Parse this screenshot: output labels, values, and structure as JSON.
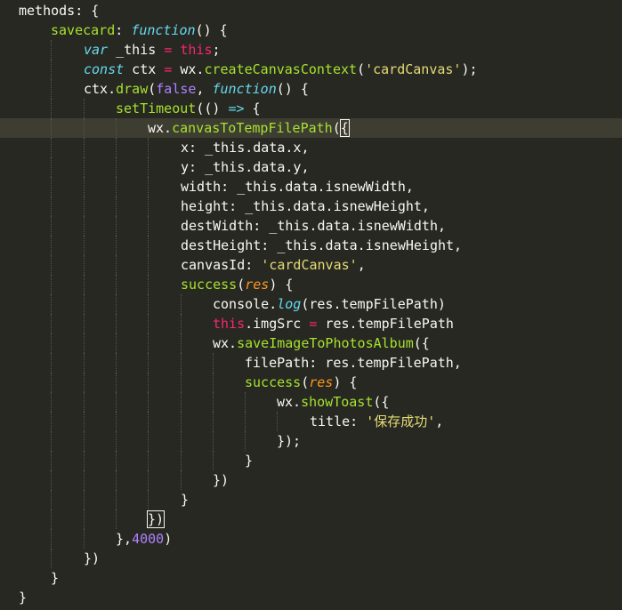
{
  "editor": {
    "theme_colors": {
      "background": "#272822",
      "current_line": "#3e3d32",
      "text": "#f8f8f2",
      "keyword": "#66d9ef",
      "function": "#a6e22e",
      "operator": "#f92672",
      "constant": "#ae81ff",
      "string": "#e6db74",
      "parameter": "#fd971f"
    },
    "current_line_index": 6,
    "lines": [
      {
        "indent": 0,
        "tokens": [
          {
            "t": "methods: {",
            "c": "pl"
          }
        ]
      },
      {
        "indent": 1,
        "tokens": [
          {
            "t": "savecard",
            "c": "fn"
          },
          {
            "t": ": ",
            "c": "pl"
          },
          {
            "t": "function",
            "c": "kw"
          },
          {
            "t": "() {",
            "c": "pl"
          }
        ]
      },
      {
        "indent": 2,
        "tokens": [
          {
            "t": "var",
            "c": "kw"
          },
          {
            "t": " _this ",
            "c": "pl"
          },
          {
            "t": "=",
            "c": "op"
          },
          {
            "t": " ",
            "c": "pl"
          },
          {
            "t": "this",
            "c": "op"
          },
          {
            "t": ";",
            "c": "pl"
          }
        ]
      },
      {
        "indent": 2,
        "tokens": [
          {
            "t": "const",
            "c": "kw"
          },
          {
            "t": " ctx ",
            "c": "pl"
          },
          {
            "t": "=",
            "c": "op"
          },
          {
            "t": " wx.",
            "c": "pl"
          },
          {
            "t": "createCanvasContext",
            "c": "fn"
          },
          {
            "t": "(",
            "c": "pl"
          },
          {
            "t": "'cardCanvas'",
            "c": "st"
          },
          {
            "t": ");",
            "c": "pl"
          }
        ]
      },
      {
        "indent": 2,
        "tokens": [
          {
            "t": "ctx.",
            "c": "pl"
          },
          {
            "t": "draw",
            "c": "fn"
          },
          {
            "t": "(",
            "c": "pl"
          },
          {
            "t": "false",
            "c": "cn"
          },
          {
            "t": ", ",
            "c": "pl"
          },
          {
            "t": "function",
            "c": "kw"
          },
          {
            "t": "() {",
            "c": "pl"
          }
        ]
      },
      {
        "indent": 3,
        "tokens": [
          {
            "t": "setTimeout",
            "c": "fn"
          },
          {
            "t": "(() ",
            "c": "pl"
          },
          {
            "t": "=>",
            "c": "kw"
          },
          {
            "t": " {",
            "c": "pl"
          }
        ]
      },
      {
        "indent": 4,
        "tokens": [
          {
            "t": "wx.",
            "c": "pl"
          },
          {
            "t": "canvasToTempFilePath",
            "c": "fn"
          },
          {
            "t": "(",
            "c": "pl"
          },
          {
            "t": "{",
            "c": "pl",
            "hl": true
          }
        ],
        "caret": true
      },
      {
        "indent": 5,
        "tokens": [
          {
            "t": "x: _this.data.x,",
            "c": "pl"
          }
        ]
      },
      {
        "indent": 5,
        "tokens": [
          {
            "t": "y: _this.data.y,",
            "c": "pl"
          }
        ]
      },
      {
        "indent": 5,
        "tokens": [
          {
            "t": "width: _this.data.isnewWidth,",
            "c": "pl"
          }
        ]
      },
      {
        "indent": 5,
        "tokens": [
          {
            "t": "height: _this.data.isnewHeight,",
            "c": "pl"
          }
        ]
      },
      {
        "indent": 5,
        "tokens": [
          {
            "t": "destWidth: _this.data.isnewWidth,",
            "c": "pl"
          }
        ]
      },
      {
        "indent": 5,
        "tokens": [
          {
            "t": "destHeight: _this.data.isnewHeight,",
            "c": "pl"
          }
        ]
      },
      {
        "indent": 5,
        "tokens": [
          {
            "t": "canvasId: ",
            "c": "pl"
          },
          {
            "t": "'cardCanvas'",
            "c": "st"
          },
          {
            "t": ",",
            "c": "pl"
          }
        ]
      },
      {
        "indent": 5,
        "tokens": [
          {
            "t": "success",
            "c": "fn"
          },
          {
            "t": "(",
            "c": "pl"
          },
          {
            "t": "res",
            "c": "pm"
          },
          {
            "t": ") {",
            "c": "pl"
          }
        ]
      },
      {
        "indent": 6,
        "tokens": [
          {
            "t": "console.",
            "c": "pl"
          },
          {
            "t": "log",
            "c": "kw"
          },
          {
            "t": "(res.tempFilePath)",
            "c": "pl"
          }
        ]
      },
      {
        "indent": 6,
        "tokens": [
          {
            "t": "this",
            "c": "op"
          },
          {
            "t": ".imgSrc ",
            "c": "pl"
          },
          {
            "t": "=",
            "c": "op"
          },
          {
            "t": " res.tempFilePath",
            "c": "pl"
          }
        ]
      },
      {
        "indent": 6,
        "tokens": [
          {
            "t": "wx.",
            "c": "pl"
          },
          {
            "t": "saveImageToPhotosAlbum",
            "c": "fn"
          },
          {
            "t": "({",
            "c": "pl"
          }
        ]
      },
      {
        "indent": 7,
        "tokens": [
          {
            "t": "filePath: res.tempFilePath,",
            "c": "pl"
          }
        ]
      },
      {
        "indent": 7,
        "tokens": [
          {
            "t": "success",
            "c": "fn"
          },
          {
            "t": "(",
            "c": "pl"
          },
          {
            "t": "res",
            "c": "pm"
          },
          {
            "t": ") {",
            "c": "pl"
          }
        ]
      },
      {
        "indent": 8,
        "tokens": [
          {
            "t": "wx.",
            "c": "pl"
          },
          {
            "t": "showToast",
            "c": "fn"
          },
          {
            "t": "({",
            "c": "pl"
          }
        ]
      },
      {
        "indent": 9,
        "tokens": [
          {
            "t": "title: ",
            "c": "pl"
          },
          {
            "t": "'保存成功'",
            "c": "st"
          },
          {
            "t": ",",
            "c": "pl"
          }
        ]
      },
      {
        "indent": 8,
        "tokens": [
          {
            "t": "});",
            "c": "pl"
          }
        ]
      },
      {
        "indent": 7,
        "tokens": [
          {
            "t": "}",
            "c": "pl"
          }
        ]
      },
      {
        "indent": 6,
        "tokens": [
          {
            "t": "})",
            "c": "pl"
          }
        ]
      },
      {
        "indent": 5,
        "tokens": [
          {
            "t": "}",
            "c": "pl"
          }
        ]
      },
      {
        "indent": 4,
        "tokens": [
          {
            "t": "})",
            "c": "pl",
            "hl": true
          }
        ]
      },
      {
        "indent": 3,
        "tokens": [
          {
            "t": "},",
            "c": "pl"
          },
          {
            "t": "4000",
            "c": "cn"
          },
          {
            "t": ")",
            "c": "pl"
          }
        ]
      },
      {
        "indent": 2,
        "tokens": [
          {
            "t": "})",
            "c": "pl"
          }
        ]
      },
      {
        "indent": 1,
        "tokens": [
          {
            "t": "}",
            "c": "pl"
          }
        ]
      },
      {
        "indent": 0,
        "tokens": [
          {
            "t": "}",
            "c": "pl"
          }
        ]
      }
    ]
  }
}
